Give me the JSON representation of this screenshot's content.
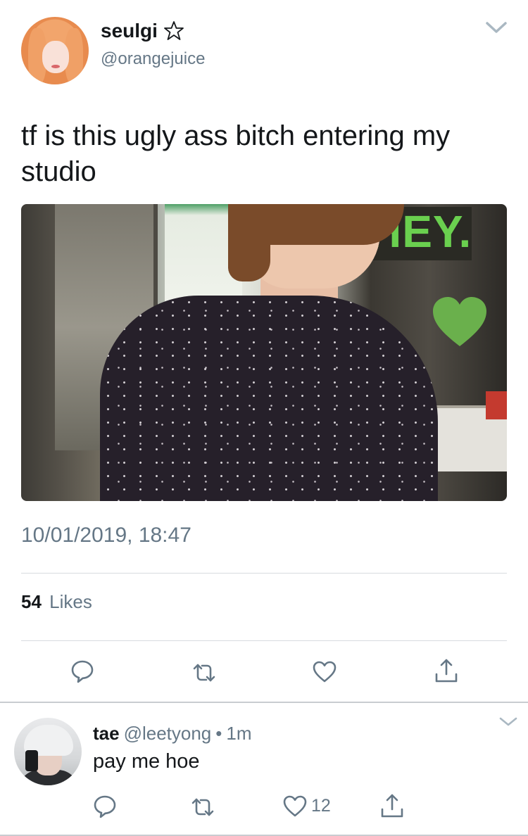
{
  "tweet": {
    "display_name": "seulgi",
    "handle": "@orangejuice",
    "text": "tf is this ugly ass bitch entering my studio",
    "photo_sign_text": "HEY.",
    "timestamp": "10/01/2019, 18:47",
    "likes_count": "54",
    "likes_label": "Likes"
  },
  "reply": {
    "display_name": "tae",
    "handle": "@leetyong",
    "separator": "•",
    "time": "1m",
    "text": "pay me hoe",
    "like_count": "12"
  },
  "icons": {
    "star": "star-outline-icon",
    "chevron": "chevron-down-icon",
    "reply": "reply-bubble-icon",
    "retweet": "retweet-icon",
    "like": "heart-outline-icon",
    "share": "share-icon",
    "sticker": "green-heart-icon"
  },
  "colors": {
    "text": "#14171a",
    "secondary": "#657786",
    "divider": "#d7dbdf",
    "sticker_green": "#6ab04c",
    "icon": "#657786"
  }
}
